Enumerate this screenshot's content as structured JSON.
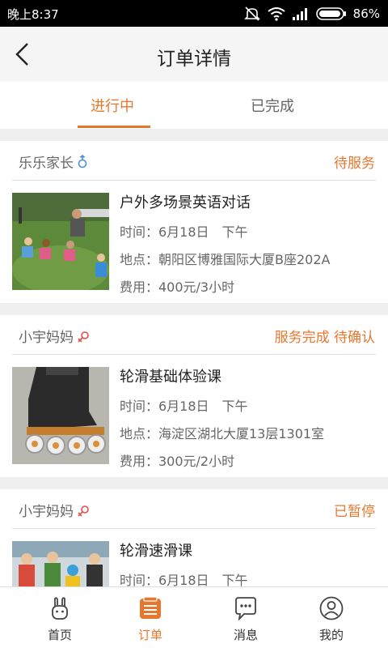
{
  "status_bar": {
    "time": "晚上8:37",
    "battery": "86%"
  },
  "header": {
    "title": "订单详情"
  },
  "tabs": [
    {
      "label": "进行中",
      "active": true
    },
    {
      "label": "已完成",
      "active": false
    }
  ],
  "orders": [
    {
      "parent": "乐乐家长",
      "gender": "male",
      "status": "待服务",
      "course": "户外多场景英语对话",
      "time": "时间：6月18日　下午",
      "location": "地点：朝阳区博雅国际大厦B座202A",
      "fee": "费用：400元/3小时"
    },
    {
      "parent": "小宇妈妈",
      "gender": "female",
      "status": "服务完成 待确认",
      "course": "轮滑基础体验课",
      "time": "时间：6月18日　下午",
      "location": "地点：海淀区湖北大厦13层1301室",
      "fee": "费用：300元/2小时"
    },
    {
      "parent": "小宇妈妈",
      "gender": "female",
      "status": "已暂停",
      "course": "轮滑速滑课",
      "time": "时间：6月18日　下午"
    }
  ],
  "bottom_nav": [
    {
      "label": "首页",
      "icon": "rabbit-home-icon"
    },
    {
      "label": "订单",
      "icon": "orders-icon",
      "active": true
    },
    {
      "label": "消息",
      "icon": "message-bubble-icon"
    },
    {
      "label": "我的",
      "icon": "profile-icon"
    }
  ],
  "colors": {
    "accent": "#e8772e",
    "male": "#4a90d9",
    "female": "#e2504a"
  }
}
